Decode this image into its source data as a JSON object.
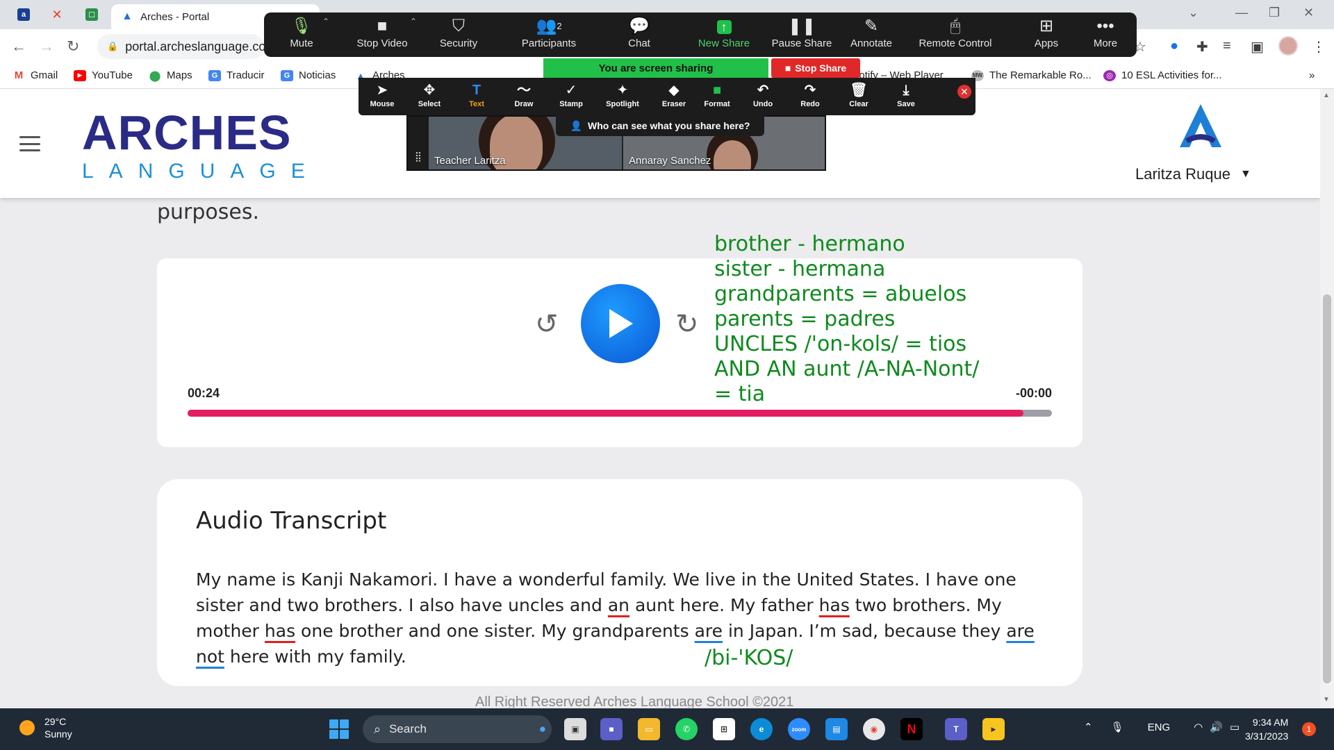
{
  "browser": {
    "tab_title": "Arches - Portal",
    "url": "portal.archeslanguage.con",
    "bookmarks": [
      {
        "label": "Gmail",
        "color": "#ea4335"
      },
      {
        "label": "YouTube",
        "color": "#ff0000"
      },
      {
        "label": "Maps",
        "color": "#34a853"
      },
      {
        "label": "Traducir",
        "color": "#4285f4"
      },
      {
        "label": "Noticias",
        "color": "#4285f4"
      },
      {
        "label": "Arches",
        "color": "#2a6edb"
      },
      {
        "label": "Spotify – Web Player",
        "color": "#1db954"
      },
      {
        "label": "The Remarkable Ro...",
        "color": "#888888"
      },
      {
        "label": "10 ESL Activities for...",
        "color": "#9c27b0"
      }
    ],
    "more_bookmarks": "»"
  },
  "zoom": {
    "toolbar": [
      {
        "label": "Mute",
        "icon": "mic-icon"
      },
      {
        "label": "Stop Video",
        "icon": "video-icon"
      },
      {
        "label": "Security",
        "icon": "shield-icon"
      },
      {
        "label": "Participants",
        "icon": "participants-icon",
        "count": "2"
      },
      {
        "label": "Chat",
        "icon": "chat-icon"
      },
      {
        "label": "New Share",
        "icon": "share-icon"
      },
      {
        "label": "Pause Share",
        "icon": "pause-icon"
      },
      {
        "label": "Annotate",
        "icon": "pen-icon"
      },
      {
        "label": "Remote Control",
        "icon": "mouse-icon"
      },
      {
        "label": "Apps",
        "icon": "apps-icon"
      },
      {
        "label": "More",
        "icon": "more-icon"
      }
    ],
    "sharing_banner": "You are screen sharing",
    "stop_share": "Stop Share",
    "annotation_tools": [
      "Mouse",
      "Select",
      "Text",
      "Draw",
      "Stamp",
      "Spotlight",
      "Eraser",
      "Format",
      "Undo",
      "Redo",
      "Clear",
      "Save"
    ],
    "who_can_see": "Who can see what you share here?",
    "participants": [
      "Teacher Laritza",
      "Annaray Sanchez"
    ]
  },
  "site": {
    "logo_word": "ARCHES",
    "logo_sub": "LANGUAGE",
    "user_name": "Laritza Ruque",
    "purposes_text": "purposes.",
    "player": {
      "current_time": "00:24",
      "remaining_time": "-00:00",
      "progress": 0.967
    },
    "transcript": {
      "title": "Audio Transcript",
      "segments": [
        {
          "text": "My name is Kanji Nakamori. I have a wonderful family. We live in the United States. I have one sister and two brothers. I also have uncles and",
          "mark": ""
        },
        {
          "text": " ",
          "mark": ""
        },
        {
          "text": "an",
          "mark": "red"
        },
        {
          "text": " aunt here. My father ",
          "mark": ""
        },
        {
          "text": "has",
          "mark": "red"
        },
        {
          "text": " two brothers. My mother ",
          "mark": ""
        },
        {
          "text": "has",
          "mark": "red"
        },
        {
          "text": " one brother and one sister. My grandparents ",
          "mark": ""
        },
        {
          "text": "are",
          "mark": "blue"
        },
        {
          "text": " in Japan. I’m sad, because they ",
          "mark": ""
        },
        {
          "text": "are not",
          "mark": "blue"
        },
        {
          "text": " here with my family.",
          "mark": ""
        }
      ]
    },
    "annotation_vocab": "brother - hermano\nsister - hermana\ngrandparents = abuelos\nparents = padres\nUNCLES /'on-kols/ = tios\nAND AN aunt /A-NA-Nont/\n= tia",
    "annotation_bikos": "/bi-'KOS/",
    "footer": "All Right Reserved Arches Language School ©2021"
  },
  "taskbar": {
    "temperature": "29°C",
    "condition": "Sunny",
    "search_label": "Search",
    "language": "ENG",
    "time": "9:34 AM",
    "date": "3/31/2023",
    "notifications": "1"
  }
}
